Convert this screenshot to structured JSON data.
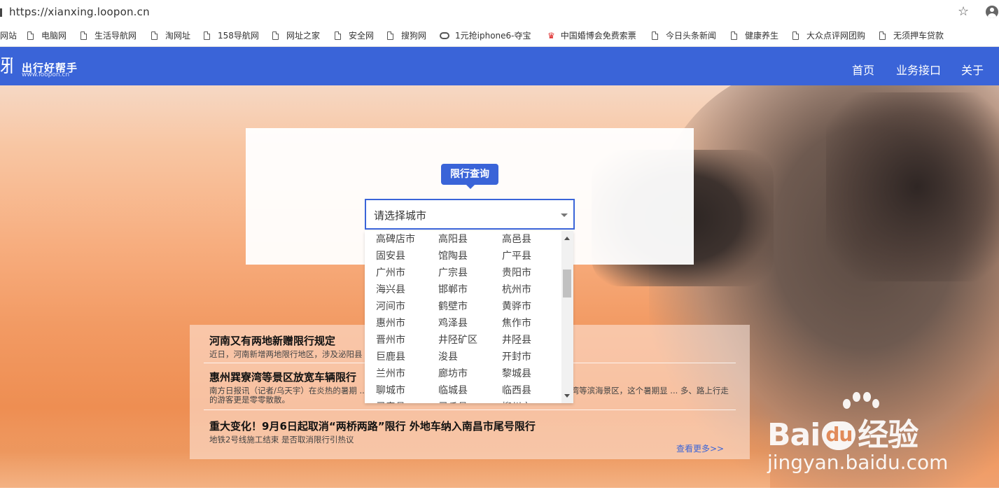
{
  "browser": {
    "url": "https://xianxing.loopon.cn",
    "bookmarks": [
      {
        "label": "网站",
        "icon": "none"
      },
      {
        "label": "电脑网",
        "icon": "doc"
      },
      {
        "label": "生活导航网",
        "icon": "doc"
      },
      {
        "label": "淘网址",
        "icon": "doc"
      },
      {
        "label": "158导航网",
        "icon": "doc"
      },
      {
        "label": "网址之家",
        "icon": "doc"
      },
      {
        "label": "安全网",
        "icon": "doc"
      },
      {
        "label": "搜狗网",
        "icon": "doc"
      },
      {
        "label": "1元抢iphone6-夺宝",
        "icon": "link"
      },
      {
        "label": "中国婚博会免费索票",
        "icon": "crown"
      },
      {
        "label": "今日头条新闻",
        "icon": "doc"
      },
      {
        "label": "健康养生",
        "icon": "doc"
      },
      {
        "label": "大众点评网团购",
        "icon": "doc"
      },
      {
        "label": "无须押车贷款",
        "icon": "doc"
      }
    ]
  },
  "site": {
    "logo_title": "出行好帮手",
    "logo_sub": "www.loopon.cn",
    "nav": [
      "首页",
      "业务接口",
      "关于"
    ]
  },
  "query": {
    "badge": "限行查询",
    "select_placeholder": "请选择城市",
    "cities": [
      [
        "高碑店市",
        "高阳县",
        "高邑县"
      ],
      [
        "固安县",
        "馆陶县",
        "广平县"
      ],
      [
        "广州市",
        "广宗县",
        "贵阳市"
      ],
      [
        "海兴县",
        "邯郸市",
        "杭州市"
      ],
      [
        "河间市",
        "鹤壁市",
        "黄骅市"
      ],
      [
        "惠州市",
        "鸡泽县",
        "焦作市"
      ],
      [
        "晋州市",
        "井陉矿区",
        "井陉县"
      ],
      [
        "巨鹿县",
        "浚县",
        "开封市"
      ],
      [
        "兰州市",
        "廊坊市",
        "黎城县"
      ],
      [
        "聊城市",
        "临城县",
        "临西县"
      ],
      [
        "灵寿县",
        "灵丘县",
        "柳州市"
      ]
    ]
  },
  "news": [
    {
      "title": "河南又有两地新赠限行规定",
      "desc": "近日，河南新增两地限行地区，涉及泌阳县 ... 地图。"
    },
    {
      "title": "惠州巽寮湾等景区放宽车辆限行",
      "desc": "南方日报讯（记者/乌天宇）在炎热的暑期 ... 而，在此前交通限行管制下的惠州市惠东县巽寮湾、双月湾等滨海景区，这个暑期显 ... 多、路上行走的游客更是零零散散。"
    },
    {
      "title": "重大变化！9月6日起取消“两桥两路”限行 外地车纳入南昌市尾号限行",
      "desc": "地铁2号线施工结束 是否取消限行引热议"
    }
  ],
  "news_more": "查看更多>>",
  "watermark": {
    "brand_a": "Bai",
    "brand_du": "du",
    "brand_b": "经验",
    "url": "jingyan.baidu.com"
  }
}
